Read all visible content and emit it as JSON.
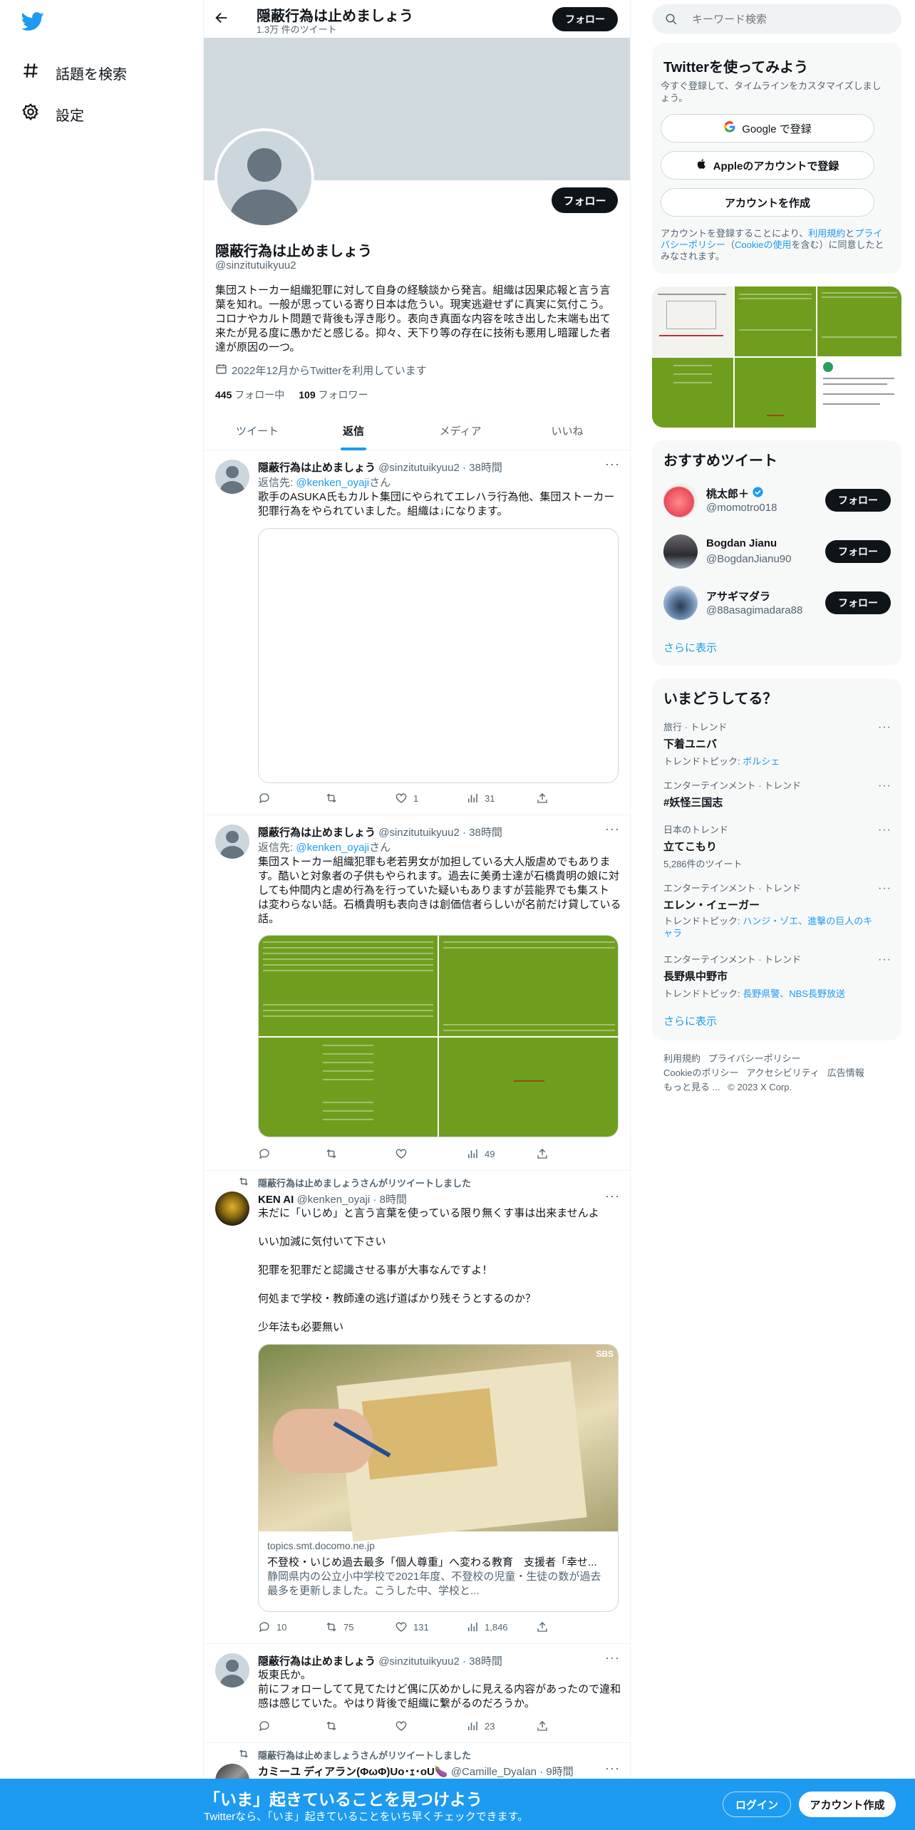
{
  "nav": {
    "explore": "話題を検索",
    "settings": "設定"
  },
  "header": {
    "title": "隠蔽行為は止めましょう",
    "tweet_count": "1.3万 件のツイート",
    "follow": "フォロー"
  },
  "profile": {
    "name": "隠蔽行為は止めましょう",
    "handle": "@sinzitutuikyuu2",
    "bio": "集団ストーカー組織犯罪に対して自身の経験談から発言。組織は因果応報と言う言葉を知れ。一般が思っている寄り日本は危うい。現実逃避せずに真実に気付こう。コロナやカルト問題で背後も浮き彫り。表向き真面な内容を呟き出した末端も出て来たが見る度に愚かだと感じる。抑々、天下り等の存在に技術も悪用し暗躍した者達が原因の一つ。",
    "joined": "2022年12月からTwitterを利用しています",
    "following_count": "445",
    "following_label": "フォロー中",
    "followers_count": "109",
    "followers_label": "フォロワー",
    "follow": "フォロー"
  },
  "tabs": [
    "ツイート",
    "返信",
    "メディア",
    "いいね"
  ],
  "tweets": [
    {
      "name": "隠蔽行為は止めましょう",
      "meta": "@sinzitutuikyuu2 · 38時間",
      "reply_prefix": "返信先: ",
      "reply_to": "@kenken_oyaji",
      "reply_suffix": "さん",
      "text": "歌手のASUKA氏もカルト集団にやられてエレハラ行為他、集団ストーカー犯罪行為をやられていました。組織は↓になります。",
      "replies": "",
      "retweets": "",
      "likes": "1",
      "views": "31"
    },
    {
      "name": "隠蔽行為は止めましょう",
      "meta": "@sinzitutuikyuu2 · 38時間",
      "reply_prefix": "返信先: ",
      "reply_to": "@kenken_oyaji",
      "reply_suffix": "さん",
      "text": "集団ストーカー組織犯罪も老若男女が加担している大人版虐めでもあります。酷いと対象者の子供もやられます。過去に美勇士達が石橋貴明の娘に対しても仲間内と虐め行為を行っていた疑いもありますが芸能界でも集スト は変わらない話。石橋貴明も表向きは創価信者らしいが名前だけ貸している話。",
      "replies": "",
      "retweets": "",
      "likes": "",
      "views": "49"
    },
    {
      "retweet_label": "隠蔽行為は止めましょうさんがリツイートしました",
      "name": "KEN AI",
      "meta": "@kenken_oyaji · 8時間",
      "lines": [
        "未だに「いじめ」と言う言葉を使っている限り無くす事は出来ませんよ",
        "いい加減に気付いて下さい",
        "犯罪を犯罪だと認識させる事が大事なんですよ！",
        "何処まで学校・教師達の逃げ道ばかり残そうとするのか？",
        "少年法も必要無い"
      ],
      "card": {
        "badge": "SBS",
        "domain": "topics.smt.docomo.ne.jp",
        "title": "不登校・いじめ過去最多「個人尊重」へ変わる教育　支援者「幸せ...",
        "desc": "静岡県内の公立小中学校で2021年度、不登校の児童・生徒の数が過去最多を更新しました。こうした中、学校と..."
      },
      "replies": "10",
      "retweets": "75",
      "likes": "131",
      "views": "1,846"
    },
    {
      "name": "隠蔽行為は止めましょう",
      "meta": "@sinzitutuikyuu2 · 38時間",
      "text": "坂東氏か。\n前にフォローしてて見てたけど偶に仄めかしに見える内容があったので違和感は感じていた。やはり背後で組織に繋がるのだろうか。",
      "replies": "",
      "retweets": "",
      "likes": "",
      "views": "23"
    },
    {
      "retweet_label": "隠蔽行為は止めましょうさんがリツイートしました",
      "name": "カミーユ ディアラン(ΦωΦ)Uo･ｪ･oU🍆",
      "meta": "@Camille_Dyalan · 9時間"
    }
  ],
  "search": {
    "placeholder": "キーワード検索"
  },
  "signup": {
    "title": "Twitterを使ってみよう",
    "subtitle": "今すぐ登録して、タイムラインをカスタマイズしましょう。",
    "google": "Google で登録",
    "apple": "Appleのアカウントで登録",
    "create": "アカウントを作成",
    "terms_1": "アカウントを登録することにより、",
    "terms_link_1": "利用規約",
    "terms_2": "と",
    "terms_link_2": "プライバシーポリシー",
    "terms_3": "（",
    "terms_link_3": "Cookieの使用",
    "terms_4": "を含む）に同意したとみなされます。"
  },
  "recommended": {
    "title": "おすすめツイート",
    "users": [
      {
        "name": "桃太郎＋",
        "handle": "@momotro018",
        "verified": true
      },
      {
        "name": "Bogdan Jianu",
        "handle": "@BogdanJianu90",
        "verified": false
      },
      {
        "name": "アサギマダラ",
        "handle": "@88asagimadara88",
        "verified": false
      }
    ],
    "follow": "フォロー",
    "more": "さらに表示"
  },
  "trends": {
    "title": "いまどうしてる？",
    "items": [
      {
        "category": "旅行 · トレンド",
        "name": "下着ユニバ",
        "sub_prefix": "トレンドトピック: ",
        "sub_link": "ボルシェ"
      },
      {
        "category": "エンターテインメント · トレンド",
        "name": "#妖怪三国志",
        "sub_prefix": "",
        "sub_link": ""
      },
      {
        "category": "日本のトレンド",
        "name": "立てこもり",
        "sub_prefix": "5,286件のツイート",
        "sub_link": ""
      },
      {
        "category": "エンターテインメント · トレンド",
        "name": "エレン・イェーガー",
        "sub_prefix": "トレンドトピック: ",
        "sub_link": "ハンジ・ゾエ、進撃の巨人のキャラ"
      },
      {
        "category": "エンターテインメント · トレンド",
        "name": "長野県中野市",
        "sub_prefix": "トレンドトピック: ",
        "sub_link": "長野県警、NBS長野放送"
      }
    ],
    "more": "さらに表示"
  },
  "footer": {
    "links": [
      "利用規約",
      "プライバシーポリシー",
      "Cookieのポリシー",
      "アクセシビリティ",
      "広告情報",
      "もっと見る ...",
      "© 2023 X Corp."
    ]
  },
  "bottom_bar": {
    "title": "「いま」起きていることを見つけよう",
    "subtitle": "Twitterなら、「いま」起きていることをいち早くチェックできます。",
    "login": "ログイン",
    "signup": "アカウント作成"
  },
  "colors": {
    "accent": "#1d9bf0",
    "dark": "#0f1419",
    "muted": "#536471",
    "banner": "#cfd9de",
    "media_green": "#6f9e1e"
  }
}
